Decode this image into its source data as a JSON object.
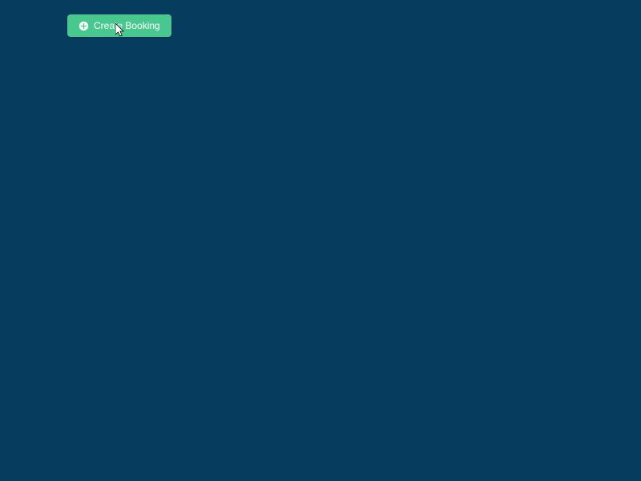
{
  "colors": {
    "background": "#063c5e",
    "button_bg": "#48c78e",
    "button_text": "#ffffff"
  },
  "button": {
    "label": "Create Booking",
    "icon": "plus-circle-icon"
  }
}
